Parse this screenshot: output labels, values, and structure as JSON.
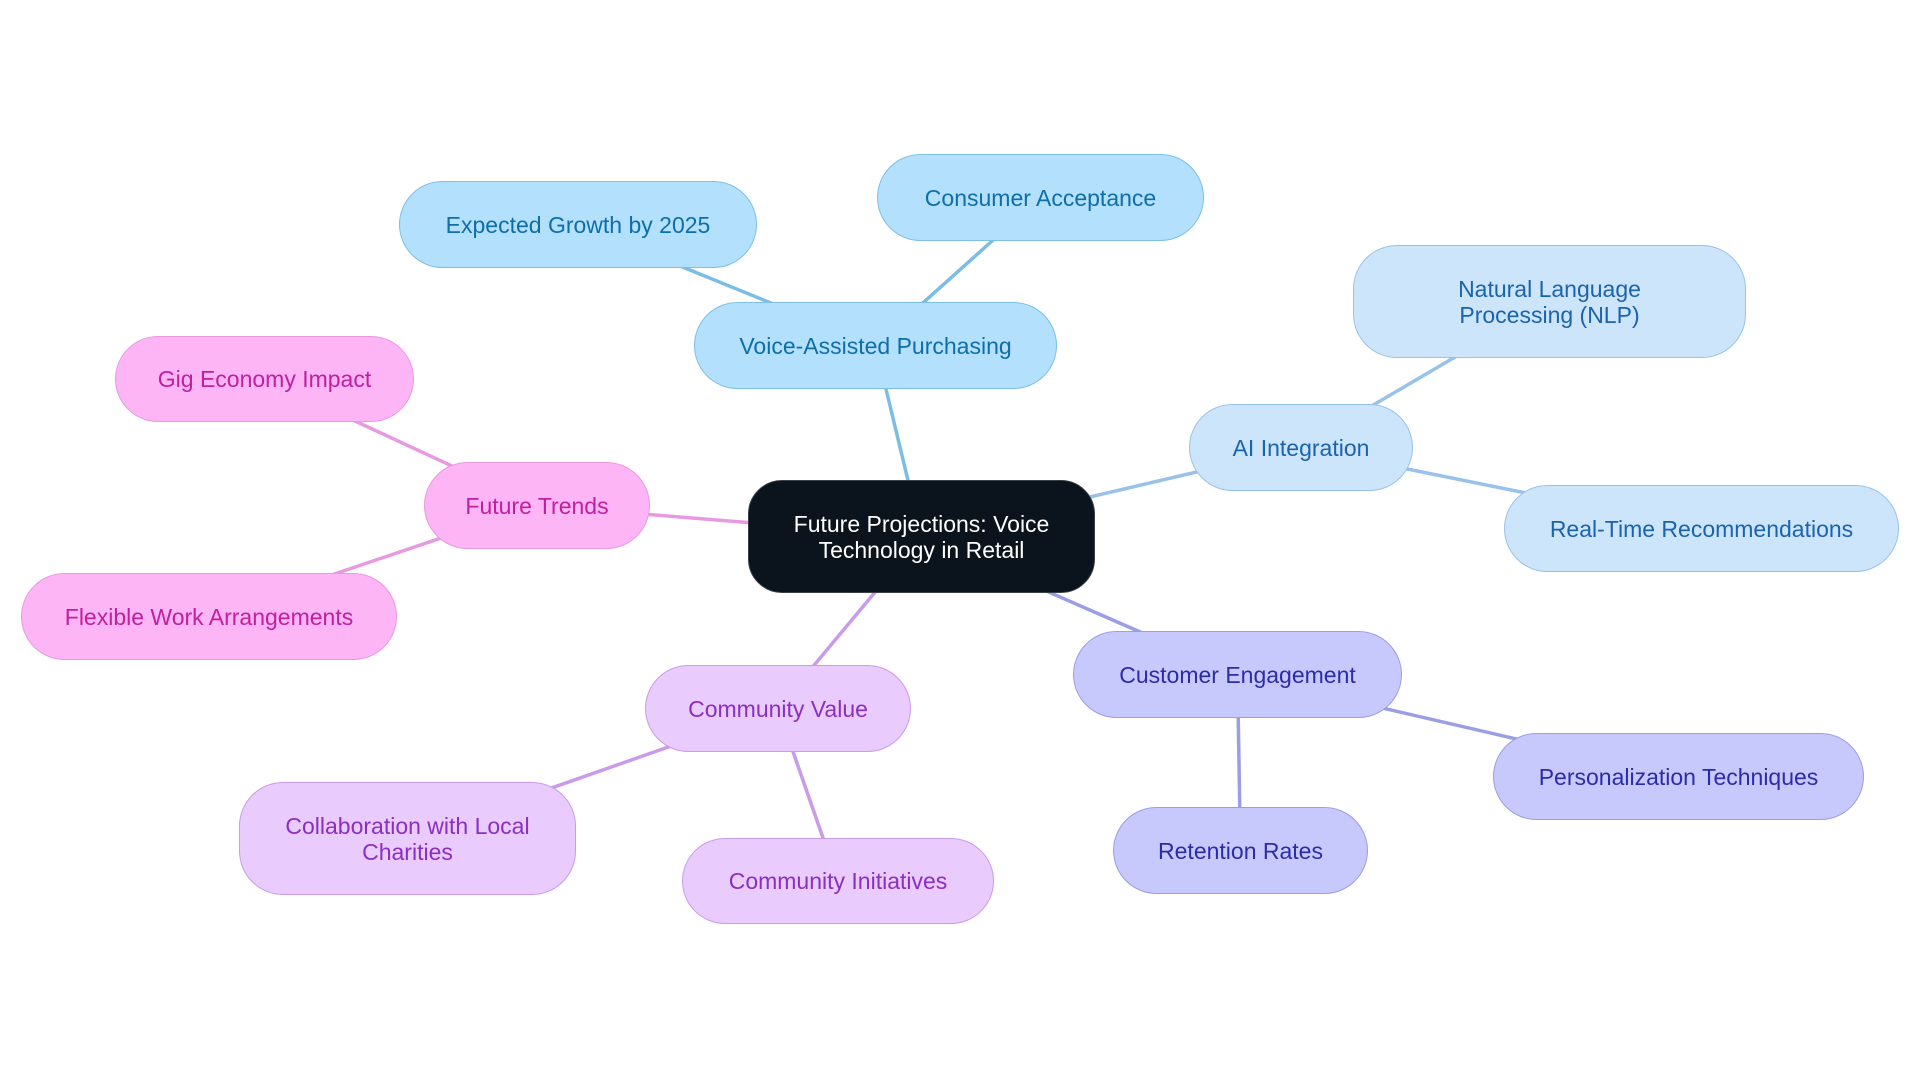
{
  "diagram": {
    "type": "mind-map",
    "root": {
      "id": "root",
      "label": "Future Projections: Voice Technology in Retail",
      "color": "#0b141c"
    },
    "branches": [
      {
        "id": "voice",
        "label": "Voice-Assisted Purchasing",
        "theme": "blue",
        "edge_color": "#7cbde6",
        "children": [
          {
            "id": "growth",
            "label": "Expected Growth by 2025"
          },
          {
            "id": "acceptance",
            "label": "Consumer Acceptance"
          }
        ]
      },
      {
        "id": "ai",
        "label": "AI Integration",
        "theme": "lblue",
        "edge_color": "#98c2ea",
        "children": [
          {
            "id": "nlp",
            "label": "Natural Language Processing (NLP)"
          },
          {
            "id": "realtime",
            "label": "Real-Time Recommendations"
          }
        ]
      },
      {
        "id": "engagement",
        "label": "Customer Engagement",
        "theme": "indigo",
        "edge_color": "#9a9ee3",
        "children": [
          {
            "id": "personalization",
            "label": "Personalization Techniques"
          },
          {
            "id": "retention",
            "label": "Retention Rates"
          }
        ]
      },
      {
        "id": "community",
        "label": "Community Value",
        "theme": "violet",
        "edge_color": "#c99be8",
        "children": [
          {
            "id": "charities",
            "label": "Collaboration with Local Charities"
          },
          {
            "id": "initiatives",
            "label": "Community Initiatives"
          }
        ]
      },
      {
        "id": "trends",
        "label": "Future Trends",
        "theme": "pink",
        "edge_color": "#e89ae0",
        "children": [
          {
            "id": "gig",
            "label": "Gig Economy Impact"
          },
          {
            "id": "flexible",
            "label": "Flexible Work Arrangements"
          }
        ]
      }
    ]
  }
}
